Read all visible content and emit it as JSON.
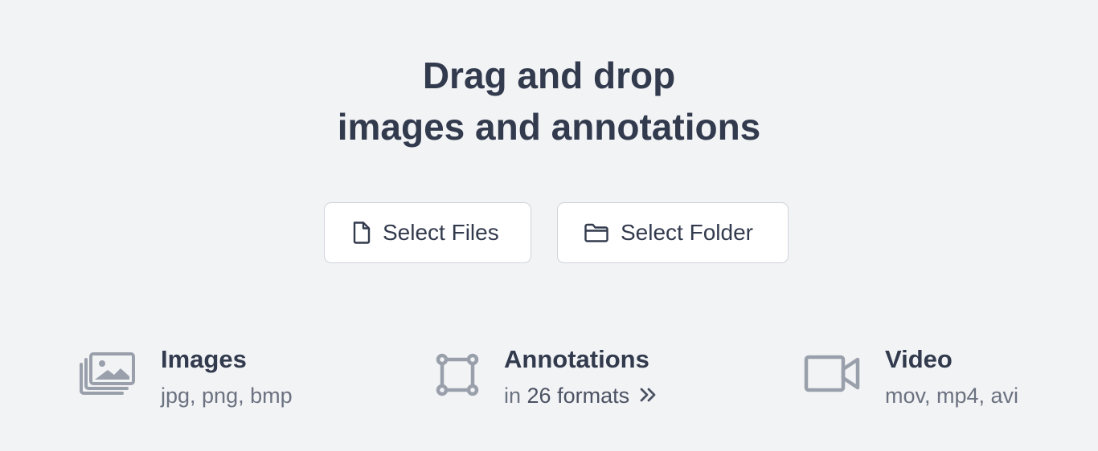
{
  "heading": {
    "line1": "Drag and drop",
    "line2": "images and annotations"
  },
  "buttons": {
    "select_files": "Select Files",
    "select_folder": "Select Folder"
  },
  "features": [
    {
      "title": "Images",
      "subtitle": "jpg, png, bmp",
      "icon": "images-icon"
    },
    {
      "title": "Annotations",
      "subtitle_prefix": "in",
      "subtitle_strong": "26 formats",
      "icon": "bounding-box-icon",
      "link_icon": "double-chevron-right-icon"
    },
    {
      "title": "Video",
      "subtitle": "mov, mp4, avi",
      "icon": "video-camera-icon"
    }
  ]
}
